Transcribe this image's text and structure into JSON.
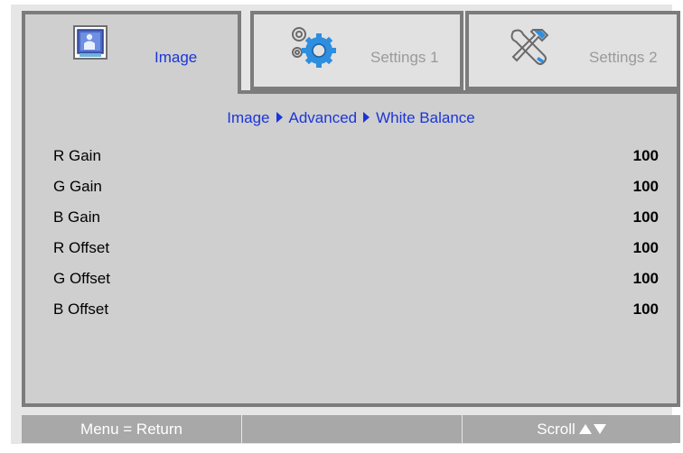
{
  "tabs": [
    {
      "label": "Image",
      "icon": "image-icon",
      "active": true
    },
    {
      "label": "Settings 1",
      "icon": "gears-icon",
      "active": false
    },
    {
      "label": "Settings 2",
      "icon": "tools-icon",
      "active": false
    }
  ],
  "breadcrumb": [
    "Image",
    "Advanced",
    "White Balance"
  ],
  "rows": [
    {
      "label": "R Gain",
      "value": "100"
    },
    {
      "label": "G Gain",
      "value": "100"
    },
    {
      "label": "B Gain",
      "value": "100"
    },
    {
      "label": "R Offset",
      "value": "100"
    },
    {
      "label": "G Offset",
      "value": "100"
    },
    {
      "label": "B Offset",
      "value": "100"
    }
  ],
  "footer": {
    "left": "Menu = Return",
    "middle": "",
    "right": "Scroll"
  },
  "colors": {
    "accent": "#1c35d8",
    "tab_border": "#7c7c7c",
    "panel": "#cfcfcf",
    "footer": "#a8a8a8"
  }
}
